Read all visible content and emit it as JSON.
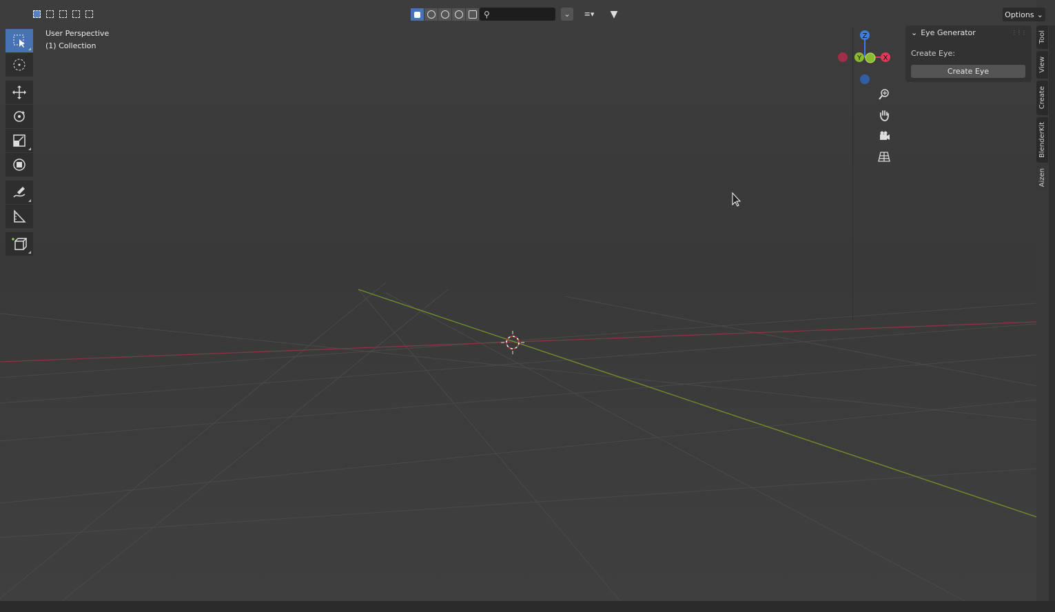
{
  "header": {
    "search": {
      "placeholder": ""
    },
    "options_label": "Options"
  },
  "viewport": {
    "perspective_label": "User Perspective",
    "collection_label": "(1) Collection"
  },
  "gizmo": {
    "z_label": "Z",
    "y_label": "Y",
    "x_label": "X",
    "colors": {
      "x": "#e0375a",
      "y": "#8ab932",
      "z": "#3b7ede"
    }
  },
  "npanel": {
    "panel_title": "Eye Generator",
    "field_label": "Create Eye:",
    "button_label": "Create Eye"
  },
  "side_tabs": [
    {
      "label": "Tool"
    },
    {
      "label": "View"
    },
    {
      "label": "Create"
    },
    {
      "label": "BlenderKit"
    },
    {
      "label": "Aizen"
    }
  ],
  "toolbar_icons": [
    "select-box-icon",
    "cursor-icon",
    "move-icon",
    "rotate-icon",
    "scale-icon",
    "transform-icon",
    "annotate-icon",
    "measure-icon",
    "add-cube-icon"
  ],
  "colors": {
    "accent": "#4772b3",
    "x_axis": "#a8364c",
    "y_axis": "#6f8e2b"
  }
}
